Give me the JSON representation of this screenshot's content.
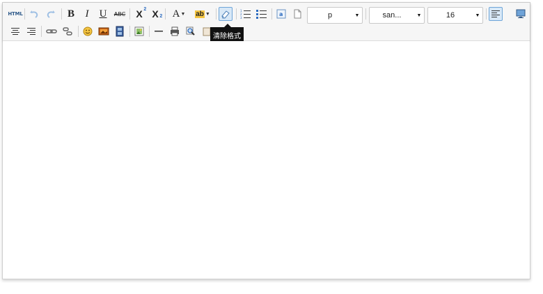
{
  "toolbar": {
    "html_label": "HTML",
    "bold_label": "B",
    "italic_label": "I",
    "underline_label": "U",
    "strike_label": "ABC",
    "superscript_label": "X",
    "superscript_mark": "2",
    "subscript_label": "X",
    "subscript_mark": "2",
    "font_color_label": "A",
    "highlight_label": "ab",
    "paragraph_value": "p",
    "font_family_value": "san...",
    "font_size_value": "16",
    "active_button": "clear-format",
    "tooltip_text": "清除格式"
  },
  "editor": {
    "content": ""
  },
  "colors": {
    "toolbar_bg": "#f6f6f6",
    "active_border": "#6ea5d8",
    "active_bg": "#d8e8f7",
    "tooltip_bg": "#111111",
    "icon_blue": "#2d6cc0"
  }
}
